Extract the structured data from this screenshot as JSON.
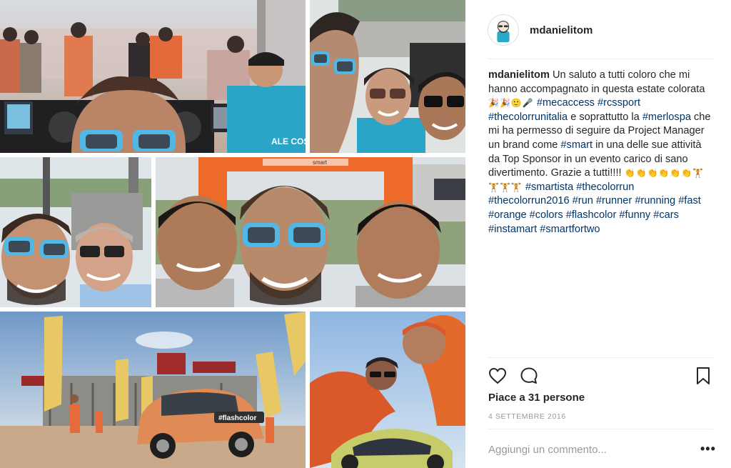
{
  "post": {
    "username": "mdanielitom",
    "caption_username": "mdanielitom",
    "caption_segments": [
      {
        "type": "text",
        "text": " Un saluto a tutti coloro che mi hanno accompagnato in questa estate colorata "
      },
      {
        "type": "emoji",
        "text": "🎉🎉🙂🎤"
      },
      {
        "type": "text",
        "text": " "
      },
      {
        "type": "tag",
        "text": "#mecaccess"
      },
      {
        "type": "text",
        "text": " "
      },
      {
        "type": "tag",
        "text": "#rcssport"
      },
      {
        "type": "text",
        "text": " "
      },
      {
        "type": "tag",
        "text": "#thecolorrunitalia"
      },
      {
        "type": "text",
        "text": " e soprattutto la "
      },
      {
        "type": "tag",
        "text": "#merlospa"
      },
      {
        "type": "text",
        "text": " che mi ha permesso di seguire da Project Manager un brand come "
      },
      {
        "type": "tag",
        "text": "#smart"
      },
      {
        "type": "text",
        "text": " in una delle sue attività da Top Sponsor in un evento carico di sano divertimento. Grazie a tutti!!!! "
      },
      {
        "type": "emoji",
        "text": "👏👏👏👏👏👏🏋🏋🏋🏋"
      },
      {
        "type": "text",
        "text": "  "
      },
      {
        "type": "tag",
        "text": "#smartista"
      },
      {
        "type": "text",
        "text": " "
      },
      {
        "type": "tag",
        "text": "#thecolorrun"
      },
      {
        "type": "text",
        "text": " "
      },
      {
        "type": "tag",
        "text": "#thecolorrun2016"
      },
      {
        "type": "text",
        "text": " "
      },
      {
        "type": "tag",
        "text": "#run"
      },
      {
        "type": "text",
        "text": " "
      },
      {
        "type": "tag",
        "text": "#runner"
      },
      {
        "type": "text",
        "text": " "
      },
      {
        "type": "tag",
        "text": "#running"
      },
      {
        "type": "text",
        "text": " "
      },
      {
        "type": "tag",
        "text": "#fast"
      },
      {
        "type": "text",
        "text": " "
      },
      {
        "type": "tag",
        "text": "#orange"
      },
      {
        "type": "text",
        "text": " "
      },
      {
        "type": "tag",
        "text": "#colors"
      },
      {
        "type": "text",
        "text": " "
      },
      {
        "type": "tag",
        "text": "#flashcolor"
      },
      {
        "type": "text",
        "text": " "
      },
      {
        "type": "tag",
        "text": "#funny"
      },
      {
        "type": "text",
        "text": " "
      },
      {
        "type": "tag",
        "text": "#cars"
      },
      {
        "type": "text",
        "text": " "
      },
      {
        "type": "tag",
        "text": "#instamart"
      },
      {
        "type": "text",
        "text": " "
      },
      {
        "type": "tag",
        "text": "#smartfortwo"
      }
    ],
    "likes_label": "Piace a 31 persone",
    "date_label": "4 SETTEMBRE 2016",
    "comment_placeholder": "Aggiungi un commento...",
    "more_label": "•••"
  },
  "icons": {
    "like": "heart-icon",
    "comment": "comment-bubble-icon",
    "save": "bookmark-icon",
    "more": "more-options-icon"
  },
  "photo_texts": {
    "shirt_print": "ALE COS",
    "banner_text": "smart",
    "car_sticker": "#flashcolor"
  },
  "colors": {
    "hashtag": "#003569",
    "text": "#262626",
    "muted": "#999999",
    "divider": "#efefef"
  }
}
